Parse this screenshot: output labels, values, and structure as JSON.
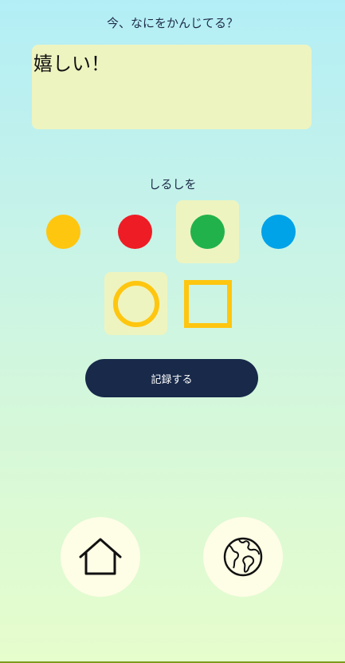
{
  "prompt": "今、なにをかんじてる？",
  "mood_input": {
    "value": "嬉しい！",
    "placeholder": ""
  },
  "mark_label": "しるしを",
  "colors": {
    "options": [
      "#fec60f",
      "#ee1c25",
      "#22b24c",
      "#00a2e8"
    ],
    "selected": "#22b24c",
    "selection_bg": "#eef4c0"
  },
  "shapes": {
    "options": [
      "circle-icon",
      "square-icon"
    ],
    "selected": "circle-icon",
    "stroke_color": "#fec60f"
  },
  "submit_label": "記録する",
  "nav": {
    "home_icon": "home-icon",
    "globe_icon": "globe-icon"
  }
}
